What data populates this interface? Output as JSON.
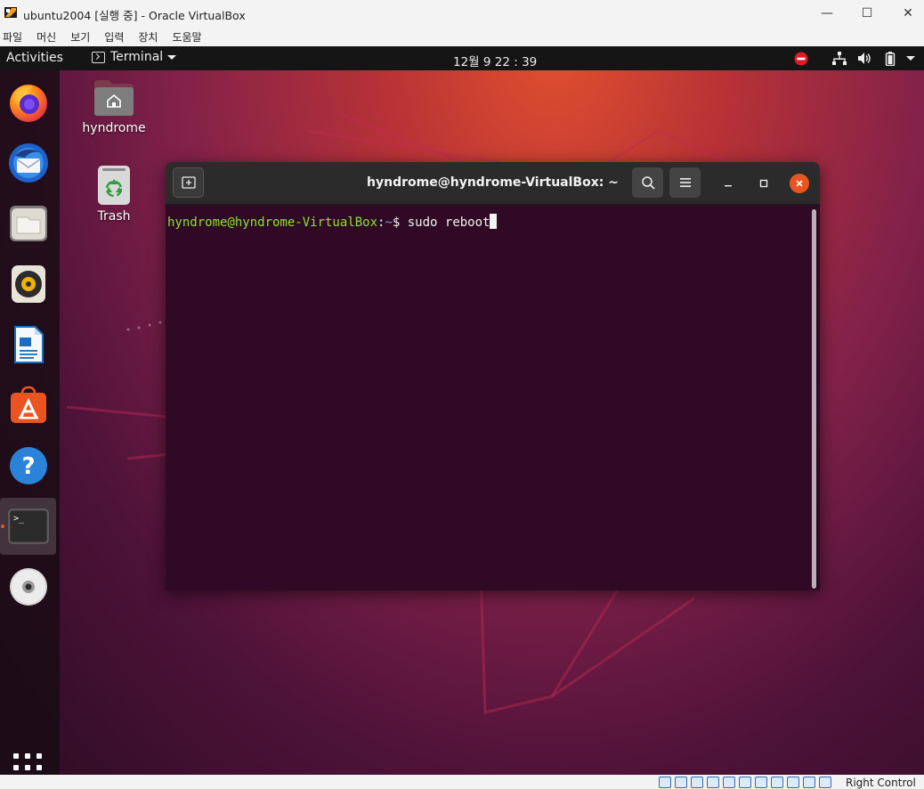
{
  "host_window": {
    "title": "ubuntu2004 [실행 중] - Oracle VirtualBox",
    "controls": {
      "minimize": "—",
      "maximize": "☐",
      "close": "✕"
    },
    "menu": [
      "파일",
      "머신",
      "보기",
      "입력",
      "장치",
      "도움말"
    ],
    "status": {
      "host_key": "Right Control"
    }
  },
  "topbar": {
    "activities": "Activities",
    "app_menu": "Terminal",
    "clock": "12월 9  22 : 39",
    "tray": [
      "do-not-disturb-icon",
      "network-icon",
      "volume-icon",
      "battery-icon",
      "system-menu-arrow-icon"
    ]
  },
  "dock": {
    "items": [
      {
        "name": "firefox",
        "icon": "firefox-icon"
      },
      {
        "name": "thunderbird",
        "icon": "thunderbird-icon"
      },
      {
        "name": "files",
        "icon": "files-icon"
      },
      {
        "name": "rhythmbox",
        "icon": "rhythmbox-icon"
      },
      {
        "name": "libreoffice-writer",
        "icon": "writer-icon"
      },
      {
        "name": "ubuntu-software",
        "icon": "software-icon"
      },
      {
        "name": "help",
        "icon": "help-icon"
      },
      {
        "name": "terminal",
        "icon": "terminal-icon",
        "active": true
      },
      {
        "name": "dvd",
        "icon": "dvd-icon"
      }
    ],
    "show_apps_icon": "app-grid-icon"
  },
  "desktop": {
    "icons": [
      {
        "label": "hyndrome",
        "icon": "home-folder-icon"
      },
      {
        "label": "Trash",
        "icon": "trash-icon"
      }
    ]
  },
  "terminal": {
    "title": "hyndrome@hyndrome-VirtualBox: ~",
    "prompt_user": "hyndrome@hyndrome-VirtualBox",
    "prompt_sep": ":",
    "prompt_path": "~",
    "prompt_symbol": "$ ",
    "command": "sudo reboot"
  },
  "colors": {
    "ubuntu_orange": "#e95420",
    "terminal_bg": "#300a24",
    "prompt_user": "#8ae234",
    "prompt_path": "#729fcf"
  }
}
